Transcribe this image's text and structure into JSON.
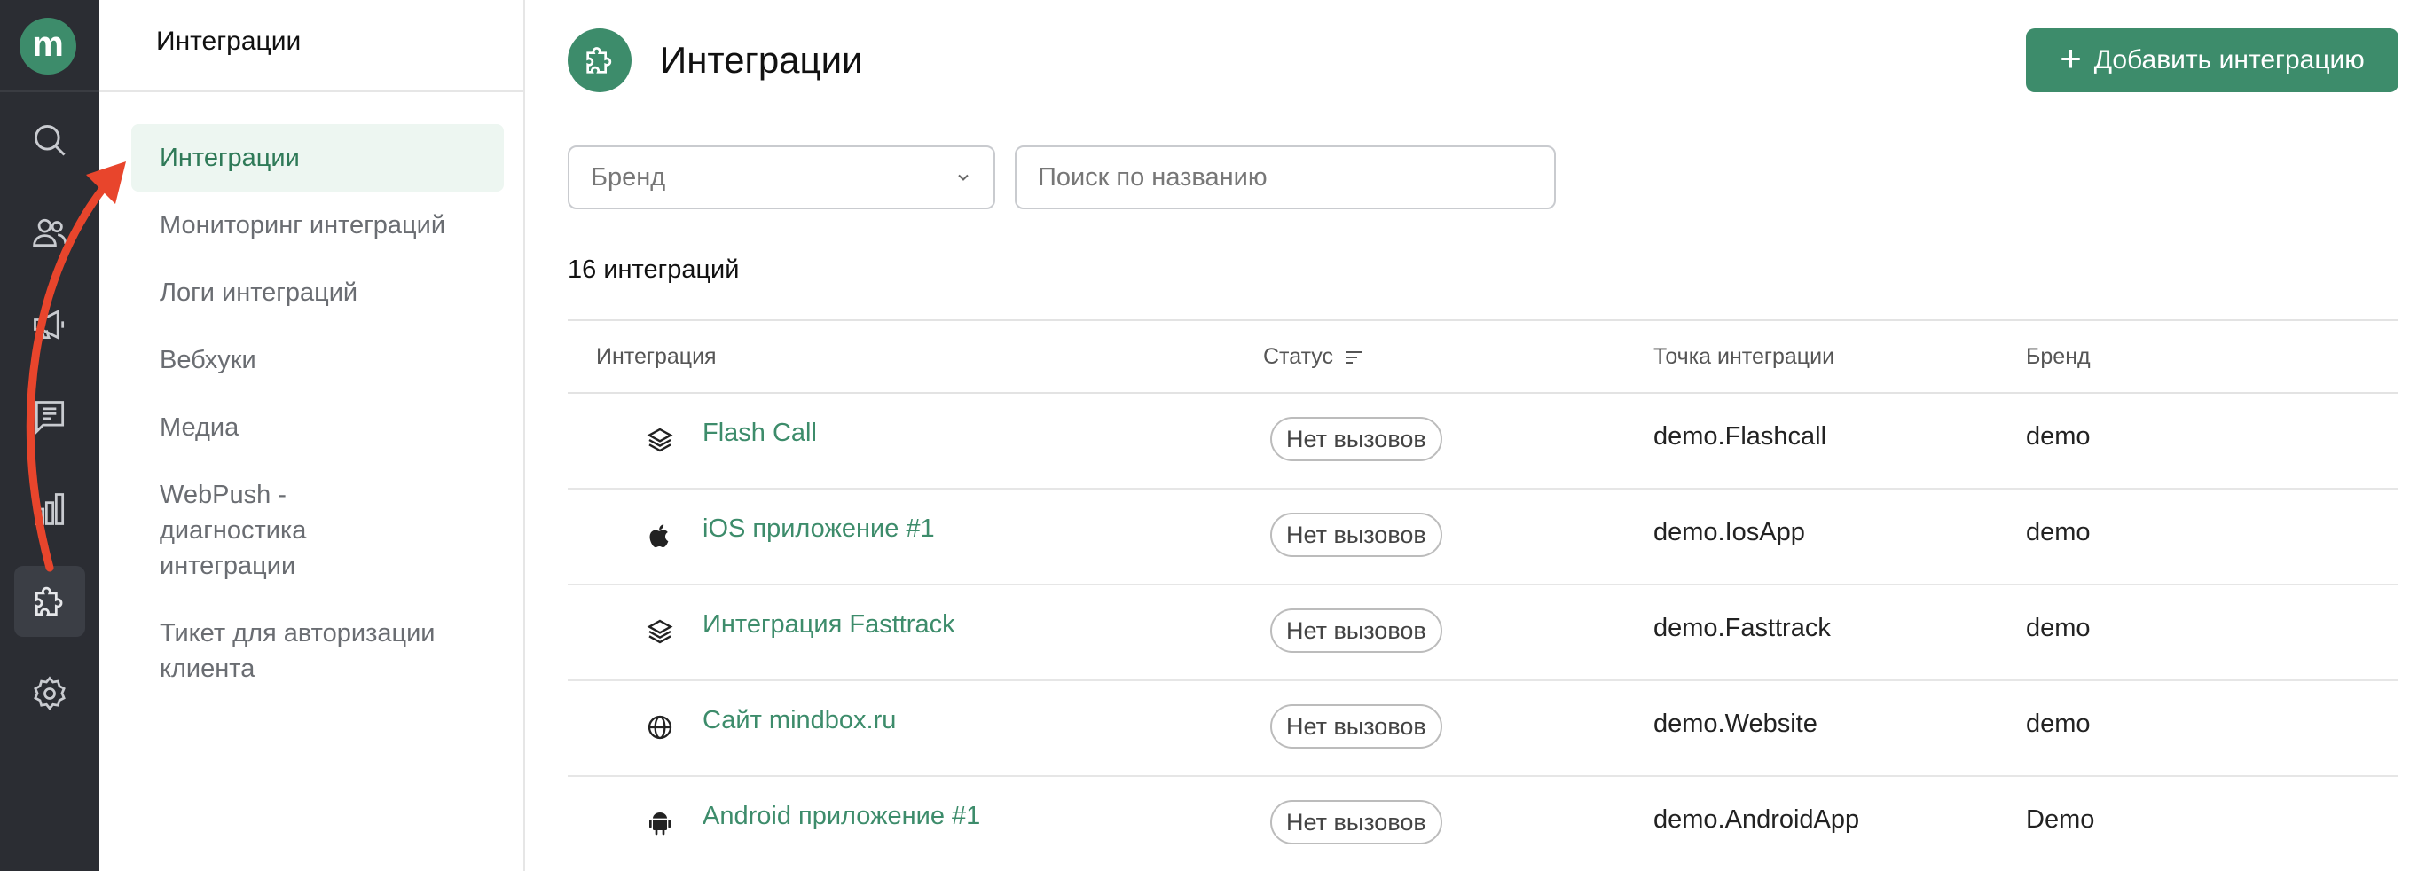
{
  "app": {
    "logo_letter": "m",
    "accent_color": "#3d8c6b",
    "rail_items": [
      {
        "name": "search-icon"
      },
      {
        "name": "users-icon"
      },
      {
        "name": "megaphone-icon"
      },
      {
        "name": "document-icon"
      },
      {
        "name": "chart-icon"
      },
      {
        "name": "puzzle-icon",
        "active": true
      },
      {
        "name": "gear-icon"
      }
    ]
  },
  "subnav": {
    "title": "Интеграции",
    "items": [
      {
        "label": "Интеграции",
        "active": true
      },
      {
        "label": "Мониторинг интеграций"
      },
      {
        "label": "Логи интеграций"
      },
      {
        "label": "Вебхуки"
      },
      {
        "label": "Медиа"
      },
      {
        "label": "WebPush - диагностика интеграции"
      },
      {
        "label": "Тикет для авторизации клиента"
      }
    ]
  },
  "header": {
    "title": "Интеграции",
    "add_button_label": "Добавить интеграцию"
  },
  "filters": {
    "brand_select": "Бренд",
    "search_placeholder": "Поиск по названию"
  },
  "count_text": "16 интеграций",
  "table": {
    "columns": [
      "Интеграция",
      "Статус",
      "Точка интеграции",
      "Бренд"
    ],
    "rows": [
      {
        "icon": "layers-icon",
        "name": "Flash Call",
        "status": "Нет вызовов",
        "point": "demo.Flashcall",
        "brand": "demo"
      },
      {
        "icon": "apple-icon",
        "name": "iOS приложение #1",
        "status": "Нет вызовов",
        "point": "demo.IosApp",
        "brand": "demo"
      },
      {
        "icon": "layers-icon",
        "name": "Интеграция Fasttrack",
        "status": "Нет вызовов",
        "point": "demo.Fasttrack",
        "brand": "demo"
      },
      {
        "icon": "globe-icon",
        "name": "Сайт mindbox.ru",
        "status": "Нет вызовов",
        "point": "demo.Website",
        "brand": "demo"
      },
      {
        "icon": "android-icon",
        "name": "Android приложение #1",
        "status": "Нет вызовов",
        "point": "demo.AndroidApp",
        "brand": "Demo"
      }
    ]
  },
  "annotation": {
    "arrow_color": "#e8452c"
  }
}
